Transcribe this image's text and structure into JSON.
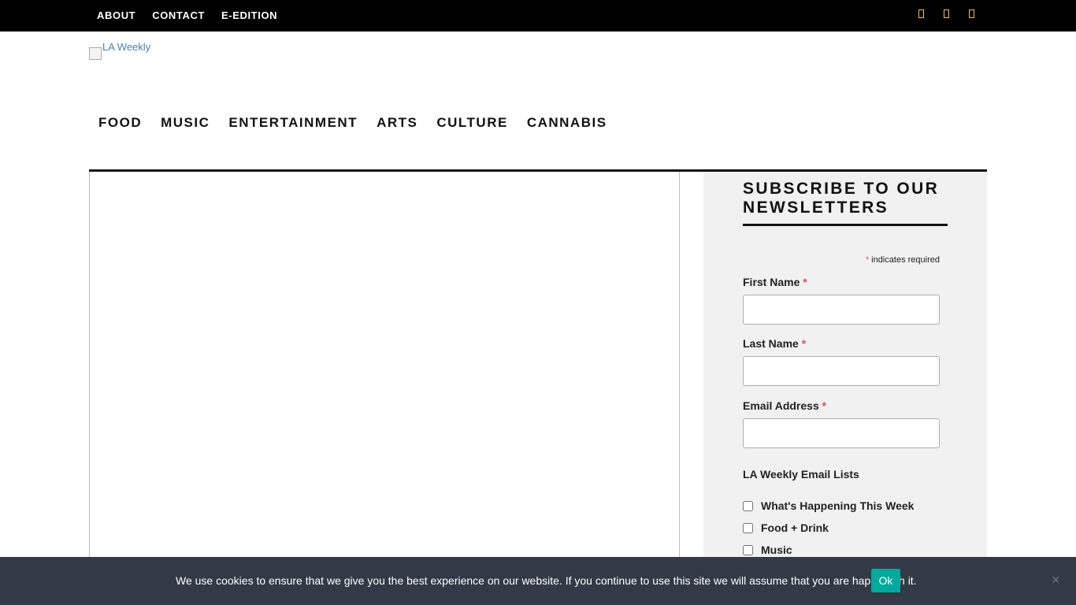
{
  "topbar": {
    "links": [
      "ABOUT",
      "CONTACT",
      "E-EDITION"
    ],
    "social_icons": [
      "facebook-icon",
      "twitter-icon",
      "instagram-icon"
    ]
  },
  "logo": {
    "alt": "LA Weekly"
  },
  "nav": {
    "items": [
      "FOOD",
      "MUSIC",
      "ENTERTAINMENT",
      "ARTS",
      "CULTURE",
      "CANNABIS"
    ]
  },
  "sidebar": {
    "title": "SUBSCRIBE TO OUR NEWSLETTERS",
    "required_star": "*",
    "required_note": "indicates required",
    "fields": [
      {
        "label": "First Name",
        "value": "",
        "placeholder": ""
      },
      {
        "label": "Last Name",
        "value": "",
        "placeholder": ""
      },
      {
        "label": "Email Address",
        "value": "",
        "placeholder": ""
      }
    ],
    "lists_label": "LA Weekly Email Lists",
    "lists": [
      {
        "label": "What's Happening This Week",
        "checked": false
      },
      {
        "label": "Food + Drink",
        "checked": false
      },
      {
        "label": "Music",
        "checked": false
      }
    ]
  },
  "cookie": {
    "message": "We use cookies to ensure that we give you the best experience on our website. If you continue to use this site we will assume that you are happy with it.",
    "ok_label": "Ok",
    "close_symbol": "×"
  },
  "colors": {
    "topbar": "#000000",
    "cookie_bg": "#323a45",
    "ok_button": "#00a99d",
    "required": "#d9534f",
    "sidebar_bg": "#f1f1f1"
  }
}
